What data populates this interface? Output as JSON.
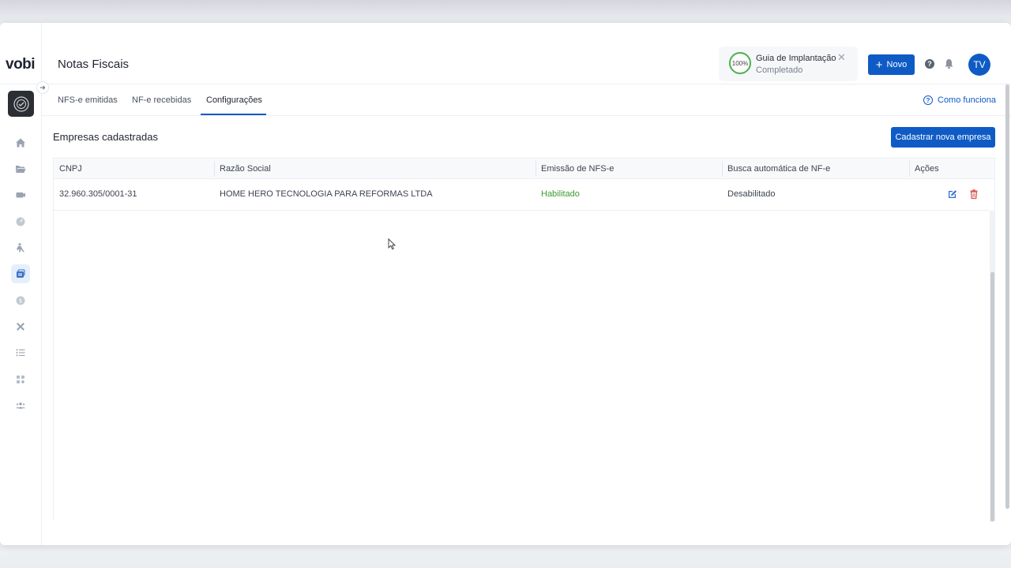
{
  "app": {
    "logo": "vobi",
    "page_title": "Notas Fiscais"
  },
  "guide": {
    "progress": "100%",
    "title": "Guia de Implantação",
    "status": "Completado"
  },
  "header": {
    "new_button": "Novo",
    "user_initials": "TV"
  },
  "tabs": [
    {
      "label": "NFS-e emitidas"
    },
    {
      "label": "NF-e recebidas"
    },
    {
      "label": "Configurações",
      "active": true
    }
  ],
  "help_link": "Como funciona",
  "section": {
    "title": "Empresas cadastradas",
    "add_button": "Cadastrar nova empresa"
  },
  "table": {
    "columns": [
      "CNPJ",
      "Razão Social",
      "Emissão de NFS-e",
      "Busca automática de NF-e",
      "Ações"
    ],
    "rows": [
      {
        "cnpj": "32.960.305/0001-31",
        "razao_social": "HOME HERO TECNOLOGIA PARA REFORMAS LTDA",
        "emissao": "Habilitado",
        "busca": "Desabilitado"
      }
    ]
  },
  "sidebar": {
    "items": [
      "home-icon",
      "folder-icon",
      "camera-icon",
      "gauge-icon",
      "worker-icon",
      "invoices-icon",
      "dollar-icon",
      "tools-icon",
      "list-icon",
      "apps-icon",
      "team-icon"
    ],
    "active_item": "invoices-icon"
  },
  "colors": {
    "primary": "#0f5bc6",
    "success": "#3d9b35",
    "danger": "#d9534f"
  }
}
